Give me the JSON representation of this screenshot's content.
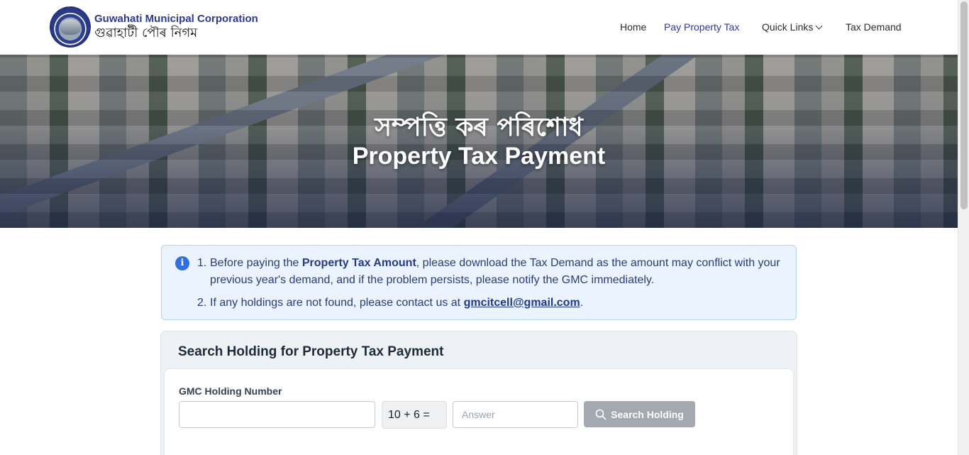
{
  "header": {
    "org_name_en": "Guwahati Municipal Corporation",
    "org_name_as": "গুৱাহাটী পৌৰ নিগম",
    "nav": {
      "home": "Home",
      "pay_property_tax": "Pay Property Tax",
      "quick_links": "Quick Links",
      "tax_demand": "Tax Demand"
    }
  },
  "hero": {
    "title_as": "সম্পত্তি কৰ পৰিশোধ",
    "title_en": "Property Tax Payment"
  },
  "notice": {
    "item1_num": "1.",
    "item1_pre": "Before paying the ",
    "item1_bold": "Property Tax Amount",
    "item1_post": ", please download the Tax Demand as the amount may conflict with your previous year's demand, and if the problem persists, please notify the GMC immediately.",
    "item2_num": "2.",
    "item2_pre": "If any holdings are not found, please contact us at ",
    "item2_email": "gmcitcell@gmail.com",
    "item2_post": "."
  },
  "search": {
    "title": "Search Holding for Property Tax Payment",
    "holding_label": "GMC Holding Number",
    "holding_value": "",
    "captcha": "10 + 6 =",
    "answer_placeholder": "Answer",
    "button_label": "Search Holding"
  },
  "colors": {
    "brand": "#2b3a8f",
    "active_nav": "#2b3aa5",
    "notice_bg": "#eaf3fe",
    "button_disabled": "#a3a8b1"
  }
}
